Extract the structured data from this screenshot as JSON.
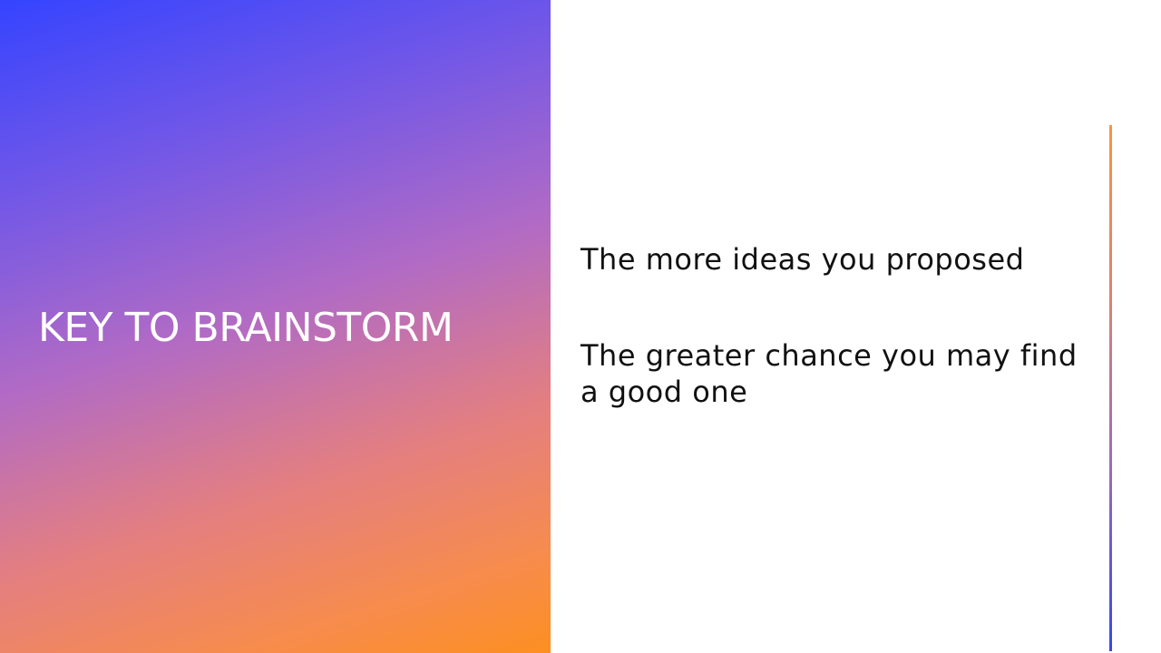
{
  "slide": {
    "title": "KEY TO BRAINSTORM",
    "bullets": [
      "The more ideas you proposed",
      "The greater chance you may find a good one"
    ]
  },
  "colors": {
    "gradient_top": "#3544ff",
    "gradient_bottom": "#fd8f21",
    "title_text": "#ffffff",
    "body_text": "#111111",
    "accent_line_top": "#f7953e",
    "accent_line_bottom": "#3848e3"
  }
}
